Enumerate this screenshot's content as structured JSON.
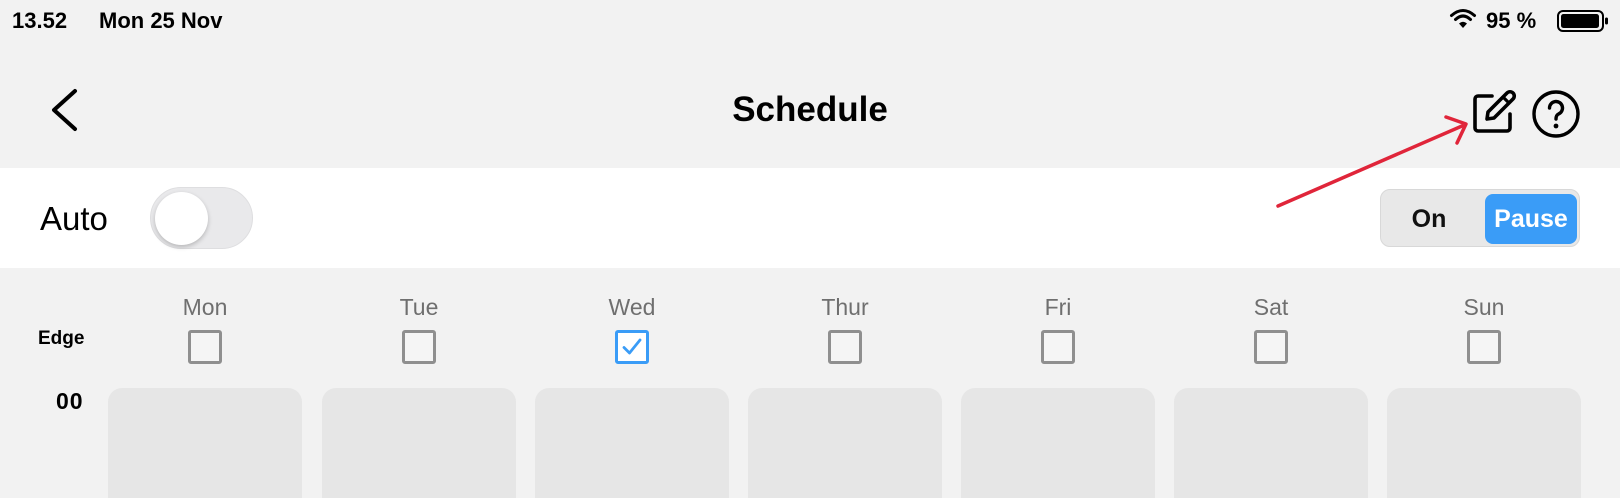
{
  "status_bar": {
    "time": "13.52",
    "date": "Mon 25 Nov",
    "battery": "95 %",
    "icons": [
      "wifi-icon",
      "battery-icon"
    ]
  },
  "nav": {
    "title": "Schedule",
    "icons": [
      "chevron-left-icon",
      "edit-icon",
      "help-icon"
    ]
  },
  "auto": {
    "label": "Auto",
    "enabled": false
  },
  "mode": {
    "options": [
      "On",
      "Pause"
    ],
    "selected": "Pause"
  },
  "grid": {
    "row_label": "Edge",
    "hour_label": "00",
    "days": [
      {
        "label": "Mon",
        "checked": false
      },
      {
        "label": "Tue",
        "checked": false
      },
      {
        "label": "Wed",
        "checked": true
      },
      {
        "label": "Thur",
        "checked": false
      },
      {
        "label": "Fri",
        "checked": false
      },
      {
        "label": "Sat",
        "checked": false
      },
      {
        "label": "Sun",
        "checked": false
      }
    ]
  },
  "colors": {
    "accent": "#3a9cf7",
    "annotation": "#e0253a",
    "background": "#f2f2f2",
    "cell": "#e6e6e6"
  }
}
